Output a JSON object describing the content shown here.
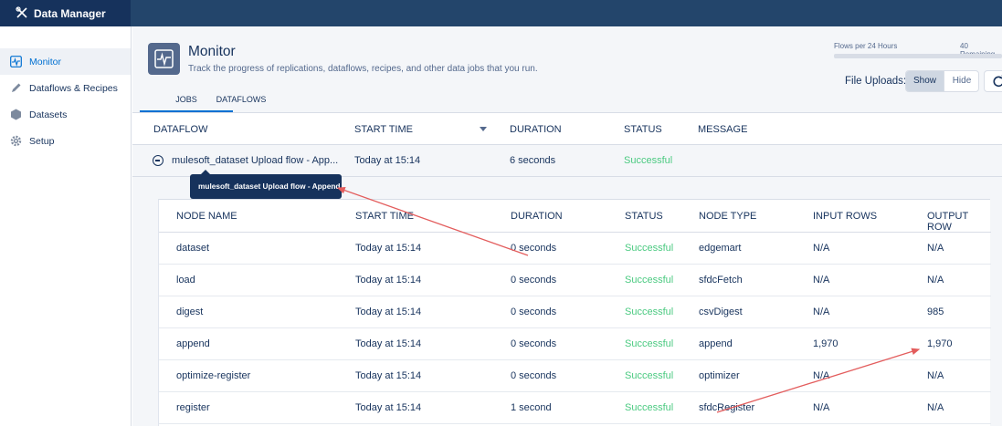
{
  "app": {
    "title": "Data Manager",
    "icon": "wrench-screwdriver-icon"
  },
  "sidebar": {
    "items": [
      {
        "label": "Monitor",
        "icon": "monitor-pulse-icon",
        "active": true
      },
      {
        "label": "Dataflows & Recipes",
        "icon": "pencil-icon",
        "active": false
      },
      {
        "label": "Datasets",
        "icon": "hexagon-icon",
        "active": false
      },
      {
        "label": "Setup",
        "icon": "gear-icon",
        "active": false
      }
    ]
  },
  "header": {
    "title": "Monitor",
    "subtitle": "Track the progress of replications, dataflows, recipes, and other data jobs that you run.",
    "icon": "pulse-icon"
  },
  "flows": {
    "label": "Flows per 24 Hours",
    "remaining": "40 Remaining",
    "used_fraction": 0.0
  },
  "file_uploads": {
    "label": "File Uploads:",
    "show": "Show",
    "hide": "Hide",
    "selected": "Show"
  },
  "tabs": [
    {
      "label": "JOBS",
      "active": true
    },
    {
      "label": "DATAFLOWS",
      "active": false
    }
  ],
  "table": {
    "headers": {
      "dataflow": "DATAFLOW",
      "start_time": "START TIME",
      "duration": "DURATION",
      "status": "STATUS",
      "message": "MESSAGE"
    },
    "flow": {
      "name": "mulesoft_dataset Upload flow - App...",
      "start_time": "Today at 15:14",
      "duration": "6 seconds",
      "status": "Successful",
      "message": ""
    }
  },
  "tooltip": "mulesoft_dataset Upload flow - Append",
  "nodes": {
    "headers": {
      "name": "NODE NAME",
      "start_time": "START TIME",
      "duration": "DURATION",
      "status": "STATUS",
      "type": "NODE TYPE",
      "input": "INPUT ROWS",
      "output": "OUTPUT ROW"
    },
    "rows": [
      {
        "name": "dataset",
        "start": "Today at 15:14",
        "duration": "0 seconds",
        "status": "Successful",
        "type": "edgemart",
        "input": "N/A",
        "output": "N/A"
      },
      {
        "name": "load",
        "start": "Today at 15:14",
        "duration": "0 seconds",
        "status": "Successful",
        "type": "sfdcFetch",
        "input": "N/A",
        "output": "N/A"
      },
      {
        "name": "digest",
        "start": "Today at 15:14",
        "duration": "0 seconds",
        "status": "Successful",
        "type": "csvDigest",
        "input": "N/A",
        "output": "985"
      },
      {
        "name": "append",
        "start": "Today at 15:14",
        "duration": "0 seconds",
        "status": "Successful",
        "type": "append",
        "input": "1,970",
        "output": "1,970"
      },
      {
        "name": "optimize-register",
        "start": "Today at 15:14",
        "duration": "0 seconds",
        "status": "Successful",
        "type": "optimizer",
        "input": "N/A",
        "output": "N/A"
      },
      {
        "name": "register",
        "start": "Today at 15:14",
        "duration": "1 second",
        "status": "Successful",
        "type": "sfdcRegister",
        "input": "N/A",
        "output": "N/A"
      }
    ]
  },
  "colors": {
    "success": "#4bca81",
    "accent": "#0070d2",
    "navy": "#16325c",
    "annotation": "#e35d5d"
  }
}
